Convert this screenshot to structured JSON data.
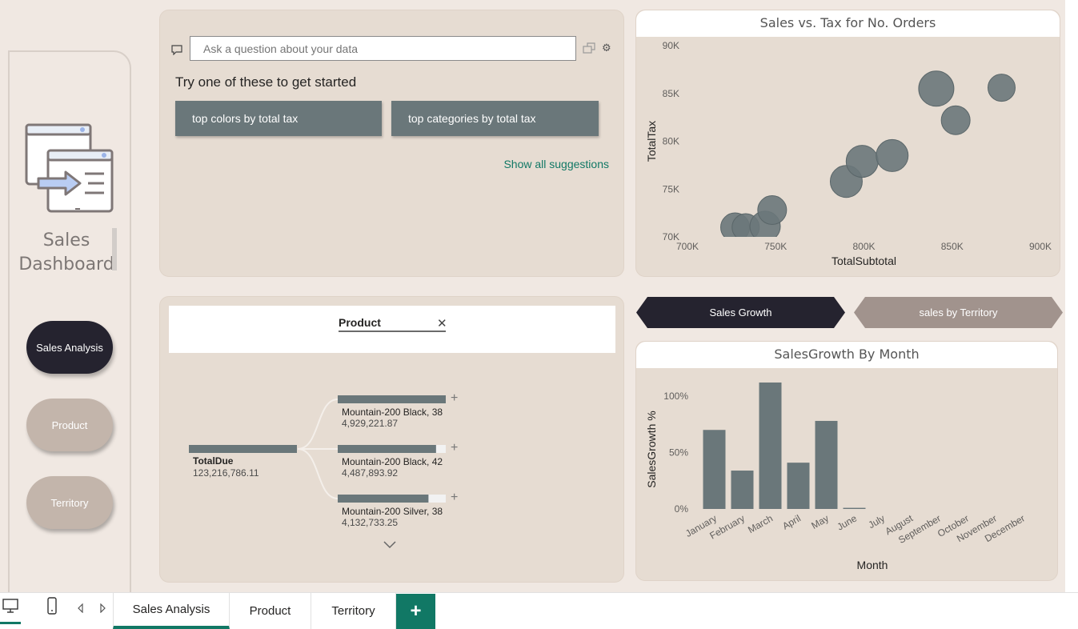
{
  "sidebar": {
    "title_line1": "Sales",
    "title_line2": "Dashboard",
    "logo_icon": "data-transfer-windows-icon",
    "nav": [
      {
        "label": "Sales Analysis",
        "active": true,
        "color": "#25232f"
      },
      {
        "label": "Product",
        "active": false,
        "color": "#c3b5ab"
      },
      {
        "label": "Territory",
        "active": false,
        "color": "#c3b5ab"
      }
    ]
  },
  "qa": {
    "placeholder": "Ask a question about your data",
    "try_text": "Try one of these to get started",
    "suggestions": [
      "top colors by total tax",
      "top categories by total tax"
    ],
    "show_all": "Show all suggestions"
  },
  "decomposition": {
    "field": "Product",
    "close_icon": "close-icon",
    "root": {
      "label": "TotalDue",
      "value": "123,216,786.11",
      "fraction": 1.0
    },
    "children": [
      {
        "label": "Mountain-200 Black, 38",
        "value": "4,929,221.87",
        "fraction": 1.0
      },
      {
        "label": "Mountain-200 Black, 42",
        "value": "4,487,893.92",
        "fraction": 0.91
      },
      {
        "label": "Mountain-200 Silver, 38",
        "value": "4,132,733.25",
        "fraction": 0.84
      }
    ],
    "expand_symbol": "+",
    "more_icon": "chevron-down-icon"
  },
  "toggles": {
    "growth": "Sales Growth",
    "territory": "sales by Territory"
  },
  "chart_data": [
    {
      "type": "scatter",
      "title": "Sales vs. Tax for No. Orders",
      "xlabel": "TotalSubtotal",
      "ylabel": "TotalTax",
      "xlim": [
        700000,
        900000
      ],
      "ylim": [
        70000,
        90000
      ],
      "xticks": [
        "700K",
        "750K",
        "800K",
        "850K",
        "900K"
      ],
      "yticks": [
        "70K",
        "75K",
        "80K",
        "85K",
        "90K"
      ],
      "xtick_values": [
        700000,
        750000,
        800000,
        850000,
        900000
      ],
      "ytick_values": [
        70000,
        75000,
        80000,
        85000,
        90000
      ],
      "color": "#6a777a",
      "points": [
        {
          "x": 727000,
          "y": 71000,
          "size": 18
        },
        {
          "x": 733000,
          "y": 71000,
          "size": 17
        },
        {
          "x": 744000,
          "y": 71100,
          "size": 19
        },
        {
          "x": 748000,
          "y": 72800,
          "size": 18
        },
        {
          "x": 790000,
          "y": 75800,
          "size": 20
        },
        {
          "x": 799000,
          "y": 77900,
          "size": 20
        },
        {
          "x": 816000,
          "y": 78500,
          "size": 20
        },
        {
          "x": 841000,
          "y": 85500,
          "size": 22
        },
        {
          "x": 852000,
          "y": 82200,
          "size": 18
        },
        {
          "x": 878000,
          "y": 85600,
          "size": 17
        }
      ]
    },
    {
      "type": "bar",
      "title": "SalesGrowth By Month",
      "xlabel": "Month",
      "ylabel": "SalesGrowth %",
      "ylim": [
        0,
        1.12
      ],
      "yticks": [
        "0%",
        "50%",
        "100%"
      ],
      "ytick_values": [
        0,
        0.5,
        1.0
      ],
      "color": "#6a777a",
      "categories": [
        "January",
        "February",
        "March",
        "April",
        "May",
        "June",
        "July",
        "August",
        "September",
        "October",
        "November",
        "December"
      ],
      "values": [
        0.7,
        0.34,
        1.12,
        0.41,
        0.78,
        0.01,
        null,
        null,
        null,
        null,
        null,
        null
      ]
    }
  ],
  "tabs": {
    "desktop_icon": "desktop-icon",
    "mobile_icon": "mobile-icon",
    "pages": [
      "Sales Analysis",
      "Product",
      "Territory"
    ],
    "active_page": "Sales Analysis",
    "add": "+"
  }
}
